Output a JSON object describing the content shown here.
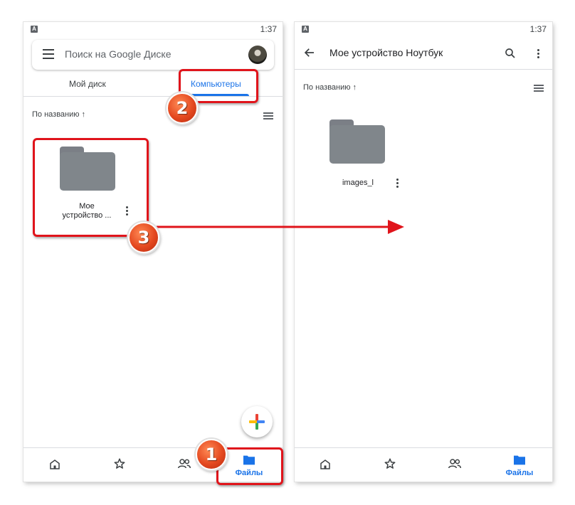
{
  "status_bar": {
    "time": "1:37",
    "notification_letter": "A"
  },
  "left_screen": {
    "search": {
      "placeholder": "Поиск на Google Диске"
    },
    "tabs": [
      {
        "label": "Мой диск"
      },
      {
        "label": "Компьютеры",
        "selected": true
      }
    ],
    "sort": {
      "label": "По названию ↑"
    },
    "folders": [
      {
        "name_line1": "Мое",
        "name_line2": "устройство ..."
      }
    ],
    "bottom_nav": {
      "active_label": "Файлы"
    }
  },
  "right_screen": {
    "title": "Мое устройство Ноутбук",
    "sort": {
      "label": "По названию ↑"
    },
    "folders": [
      {
        "name": "images_l"
      }
    ],
    "bottom_nav": {
      "active_label": "Файлы"
    }
  },
  "annotations": {
    "badge_1": "1",
    "badge_2": "2",
    "badge_3": "3"
  },
  "colors": {
    "accent": "#1a73e8",
    "highlight": "#e0141b",
    "folder": "#80868b"
  }
}
